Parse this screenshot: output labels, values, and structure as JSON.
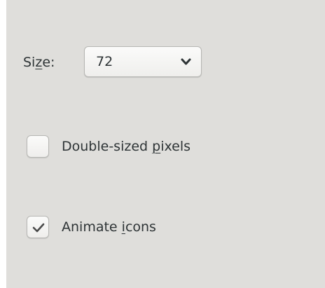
{
  "size": {
    "label_pre": "Si",
    "label_mnemonic": "z",
    "label_post": "e:",
    "selected_value": "72"
  },
  "double_sized": {
    "label_pre": "Double-sized ",
    "label_mnemonic": "p",
    "label_post": "ixels",
    "checked": false
  },
  "animate": {
    "label_pre": "Animate ",
    "label_mnemonic": "i",
    "label_post": "cons",
    "checked": true
  },
  "icons": {
    "dropdown": "chevron-down-icon",
    "check": "checkmark-icon"
  },
  "colors": {
    "panel_bg": "#dfdedb",
    "text": "#2e3436"
  }
}
